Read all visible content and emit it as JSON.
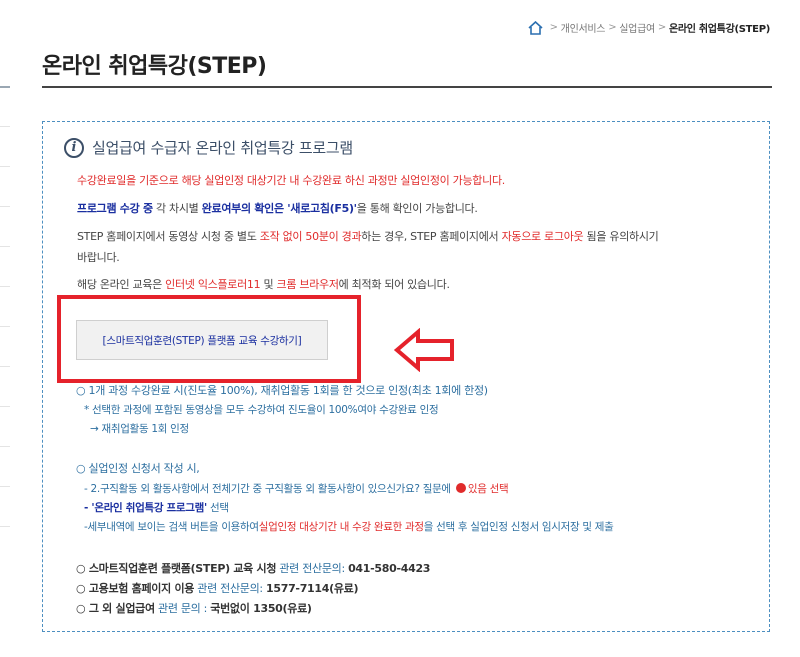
{
  "breadcrumb": {
    "home_icon": "home-icon",
    "items": [
      "개인서비스",
      "실업급여"
    ],
    "current": "온라인 취업특강(STEP)",
    "separator": ">"
  },
  "page_title": "온라인 취업특강(STEP)",
  "box": {
    "icon": "info-icon",
    "icon_glyph": "i",
    "title": "실업급여 수급자 온라인 취업특강 프로그램",
    "line1": "수강완료일을 기준으로 해당 실업인정 대상기간 내 수강완료 하신 과정만 실업인정이 가능합니다.",
    "line2": {
      "a": "프로그램 수강 중",
      "b": " 각 차시별 ",
      "c": "완료여부의 확인은 '새로고침(F5)'",
      "d": "을 통해 확인이 가능합니다."
    },
    "line3": {
      "a": "STEP 홈페이지에서 동영상 시청 중 별도 ",
      "b": "조작 없이 50분이 경과",
      "c": "하는 경우, STEP 홈페이지에서 ",
      "d": "자동으로 로그아웃",
      "e": " 됨을 유의하시기",
      "f": "바랍니다."
    },
    "line4": {
      "a": "해당 온라인 교육은 ",
      "b": "인터넷 익스플로러11",
      "c": " 및 ",
      "d": "크롬 브라우저",
      "e": "에 최적화 되어 있습니다."
    },
    "button_label": "[스마트직업훈련(STEP) 플랫폼 교육 수강하기]",
    "arrow_icon": "arrow-left-icon",
    "note1": {
      "main": "○ 1개 과정 수강완료 시(진도율 100%), 재취업활동 1회를 한 것으로 인정(최초 1회에 한정)",
      "sub1": "* 선택한 과정에 포함된 동영상을 모두 수강하여 진도율이 100%여야 수강완료 인정",
      "sub2": "→ 재취업활동 1회 인정"
    },
    "note2": {
      "main": "○ 실업인정 신청서 작성 시,",
      "sub1_a": "- 2.구직활동 외 활동사항에서 전체기간 중 구직활동 외 활동사항이 있으신가요? 질문에 ",
      "sub1_b": "있음 선택",
      "sub2_a": "- '온라인 취업특강 프로그램'",
      "sub2_b": " 선택",
      "sub3_a": "-세부내역에 보이는 검색 버튼을 이용하여",
      "sub3_b": "실업인정 대상기간 내 수강 완료한 과정",
      "sub3_c": "을 선택 후 실업인정 신청서 임시저장 및 제출"
    },
    "contacts": [
      {
        "prefix": "○ ",
        "name": "스마트직업훈련 플랫폼(STEP) 교육 시청",
        "mid": " 관련 전산문의: ",
        "value": "041-580-4423"
      },
      {
        "prefix": "○ ",
        "name": "고용보험 홈페이지 이용",
        "mid": " 관련 전산문의: ",
        "value": "1577-7114(유료)"
      },
      {
        "prefix": "○ ",
        "name": "그 외 실업급여",
        "mid": " 관련 문의 : ",
        "value": "국번없이 1350(유료)"
      }
    ]
  },
  "colors": {
    "red": "#e02b2b",
    "blue": "#1a2fa0",
    "frame": "#e5222b",
    "box_border": "#4d8fc0"
  }
}
